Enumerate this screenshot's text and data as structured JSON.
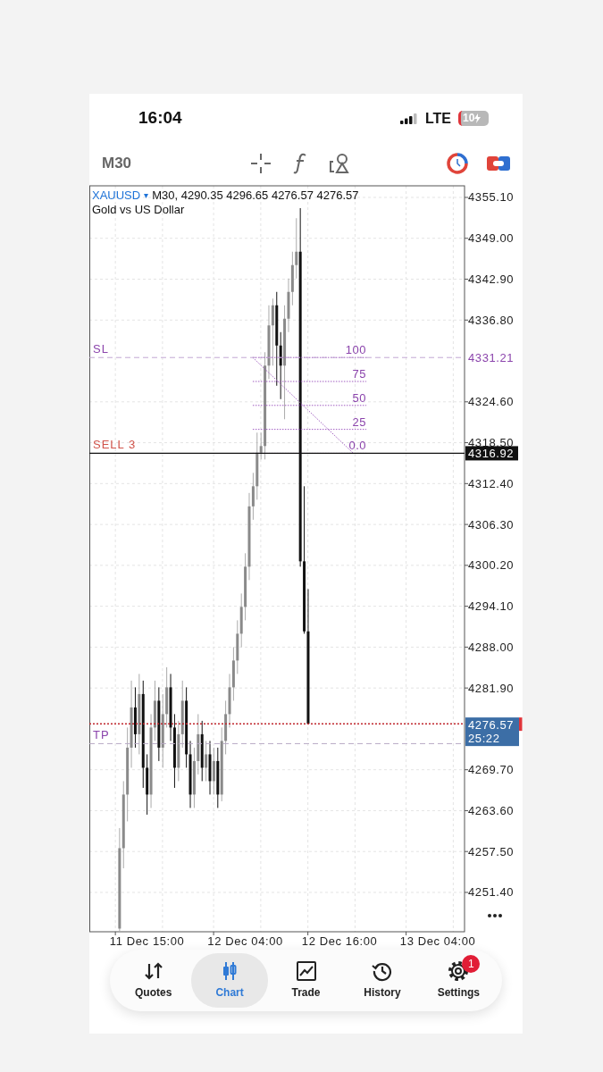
{
  "status_bar": {
    "time": "16:04",
    "network": "LTE",
    "battery": "10"
  },
  "toolbar": {
    "timeframe": "M30"
  },
  "chart": {
    "symbol": "XAUUSD",
    "caret": "▾",
    "quote": "M30, 4290.35 4296.65 4276.57 4276.57",
    "description": "Gold vs US Dollar",
    "price_tags": [
      {
        "kind": "stop_loss",
        "text": "4331.21"
      },
      {
        "kind": "order",
        "text": "4316.92"
      },
      {
        "kind": "bid",
        "text": "4276.57",
        "timer": "25:22"
      }
    ],
    "chart_data": {
      "type": "candlestick",
      "grid": true,
      "categories": [
        null,
        null,
        null,
        null,
        null,
        null,
        null,
        null,
        "11 Dec 15:00",
        null,
        null,
        null,
        null,
        null,
        null,
        null,
        null,
        null,
        null,
        null,
        null,
        null,
        null,
        null,
        null,
        null,
        null,
        null,
        null,
        null,
        null,
        null,
        null,
        "12 Dec 04:00",
        null,
        null,
        null,
        null,
        null,
        null,
        null,
        null,
        null,
        null,
        null,
        null,
        null,
        null,
        null,
        null,
        null,
        null,
        null,
        null,
        null,
        null,
        null,
        "12 Dec 16:00",
        null,
        null,
        null,
        null,
        null,
        null,
        null,
        null,
        null,
        null,
        null,
        null,
        null,
        null,
        null,
        null,
        null,
        null,
        null,
        null,
        null,
        null,
        null,
        null,
        "13 Dec 04:00"
      ],
      "ylim": [
        4245.53,
        4356.83
      ],
      "yticks": [
        {
          "value": 4355.1,
          "label": "4355.10"
        },
        {
          "value": 4349.0,
          "label": "4349.00"
        },
        {
          "value": 4342.9,
          "label": "4342.90"
        },
        {
          "value": 4336.8,
          "label": "4336.80"
        },
        {
          "value": 4324.6,
          "label": "4324.60"
        },
        {
          "value": 4318.5,
          "label": "4318.50"
        },
        {
          "value": 4312.4,
          "label": "4312.40"
        },
        {
          "value": 4306.3,
          "label": "4306.30"
        },
        {
          "value": 4300.2,
          "label": "4300.20"
        },
        {
          "value": 4294.1,
          "label": "4294.10"
        },
        {
          "value": 4288.0,
          "label": "4288.00"
        },
        {
          "value": 4281.9,
          "label": "4281.90"
        },
        {
          "value": 4269.7,
          "label": "4269.70"
        },
        {
          "value": 4263.6,
          "label": "4263.60"
        },
        {
          "value": 4257.5,
          "label": "4257.50"
        },
        {
          "value": 4251.4,
          "label": "4251.40"
        }
      ],
      "ohlc": [
        null,
        [
          4246,
          4261,
          4245.6,
          4258
        ],
        [
          4258,
          4268,
          4255,
          4266
        ],
        [
          4266,
          4276,
          4262,
          4273
        ],
        [
          4273,
          4283,
          4270,
          4279
        ],
        [
          4279,
          4282,
          4273,
          4275
        ],
        [
          4275,
          4284,
          4272,
          4281
        ],
        [
          4281,
          4283,
          4267,
          4270
        ],
        [
          4270,
          4272,
          4263,
          4266
        ],
        [
          4266,
          4278,
          4264,
          4276
        ],
        [
          4276,
          4283,
          4274,
          4280
        ],
        [
          4280,
          4282,
          4271,
          4273
        ],
        [
          4273,
          4281,
          4270,
          4278
        ],
        [
          4278,
          4285,
          4276,
          4282
        ],
        [
          4282,
          4284,
          4274,
          4276
        ],
        [
          4276,
          4278,
          4267,
          4270
        ],
        [
          4270,
          4277,
          4268,
          4275
        ],
        [
          4275,
          4283,
          4273,
          4280
        ],
        [
          4280,
          4282,
          4270,
          4272
        ],
        [
          4272,
          4274,
          4264,
          4266
        ],
        [
          4266,
          4273,
          4264,
          4271
        ],
        [
          4271,
          4278,
          4269,
          4275
        ],
        [
          4275,
          4277,
          4268,
          4270
        ],
        [
          4270,
          4274,
          4268,
          4272
        ],
        [
          4272,
          4274,
          4266,
          4268
        ],
        [
          4268,
          4273,
          4266,
          4271
        ],
        [
          4271,
          4273,
          4264,
          4266
        ],
        [
          4266,
          4276,
          4265,
          4274
        ],
        [
          4274,
          4280,
          4272,
          4278
        ],
        [
          4278,
          4284,
          4276,
          4282
        ],
        [
          4282,
          4288,
          4280,
          4286
        ],
        [
          4286,
          4292,
          4284,
          4290
        ],
        [
          4290,
          4296,
          4288,
          4294
        ],
        [
          4294,
          4302,
          4292,
          4300
        ],
        [
          4300,
          4311,
          4298,
          4309
        ],
        [
          4309,
          4314,
          4307,
          4312
        ],
        [
          4312,
          4320,
          4310,
          4317
        ],
        [
          4317,
          4320,
          4316,
          4318
        ],
        [
          4318,
          4332,
          4316,
          4330
        ],
        [
          4330,
          4339,
          4328,
          4336
        ],
        [
          4336,
          4340,
          4330,
          4339
        ],
        [
          4339,
          4341,
          4327,
          4333
        ],
        [
          4333,
          4335,
          4325,
          4330
        ],
        [
          4330,
          4339,
          4322,
          4337
        ],
        [
          4337,
          4343,
          4335,
          4341
        ],
        [
          4341,
          4347,
          4339,
          4345
        ],
        [
          4345,
          4352,
          4343,
          4347
        ],
        [
          4347,
          4353.5,
          4300,
          4300.8
        ],
        [
          4300.8,
          4312,
          4290,
          4290.35
        ],
        [
          4290.35,
          4296.65,
          4276.57,
          4276.57
        ],
        null,
        null,
        null,
        null,
        null,
        null,
        null,
        null,
        null,
        null,
        null,
        null,
        null,
        null,
        null,
        null,
        null,
        null,
        null,
        null,
        null,
        null,
        null,
        null,
        null,
        null,
        null,
        null,
        null,
        null,
        null,
        null,
        null
      ],
      "ref_lines": [
        {
          "axis": "y",
          "value": 4273.6,
          "label": "TP",
          "color": "#b7aac4"
        },
        {
          "axis": "y",
          "value": 4331.21,
          "label": "SL",
          "color": "#c3a6d3"
        },
        {
          "axis": "y",
          "value": 4316.92,
          "label": "SELL 3",
          "color": "#111111"
        },
        {
          "axis": "y",
          "value": 4276.57,
          "color": "#c0262d"
        }
      ],
      "annotations": [
        "100",
        "75",
        "50",
        "25",
        "0.0"
      ]
    }
  },
  "nav": {
    "tabs": [
      {
        "kind": "quotes",
        "label": "Quotes",
        "selected": false
      },
      {
        "kind": "chart",
        "label": "Chart",
        "selected": true
      },
      {
        "kind": "trade",
        "label": "Trade",
        "selected": false
      },
      {
        "kind": "history",
        "label": "History",
        "selected": false
      },
      {
        "kind": "settings",
        "label": "Settings",
        "selected": false,
        "badge": "1"
      }
    ]
  }
}
